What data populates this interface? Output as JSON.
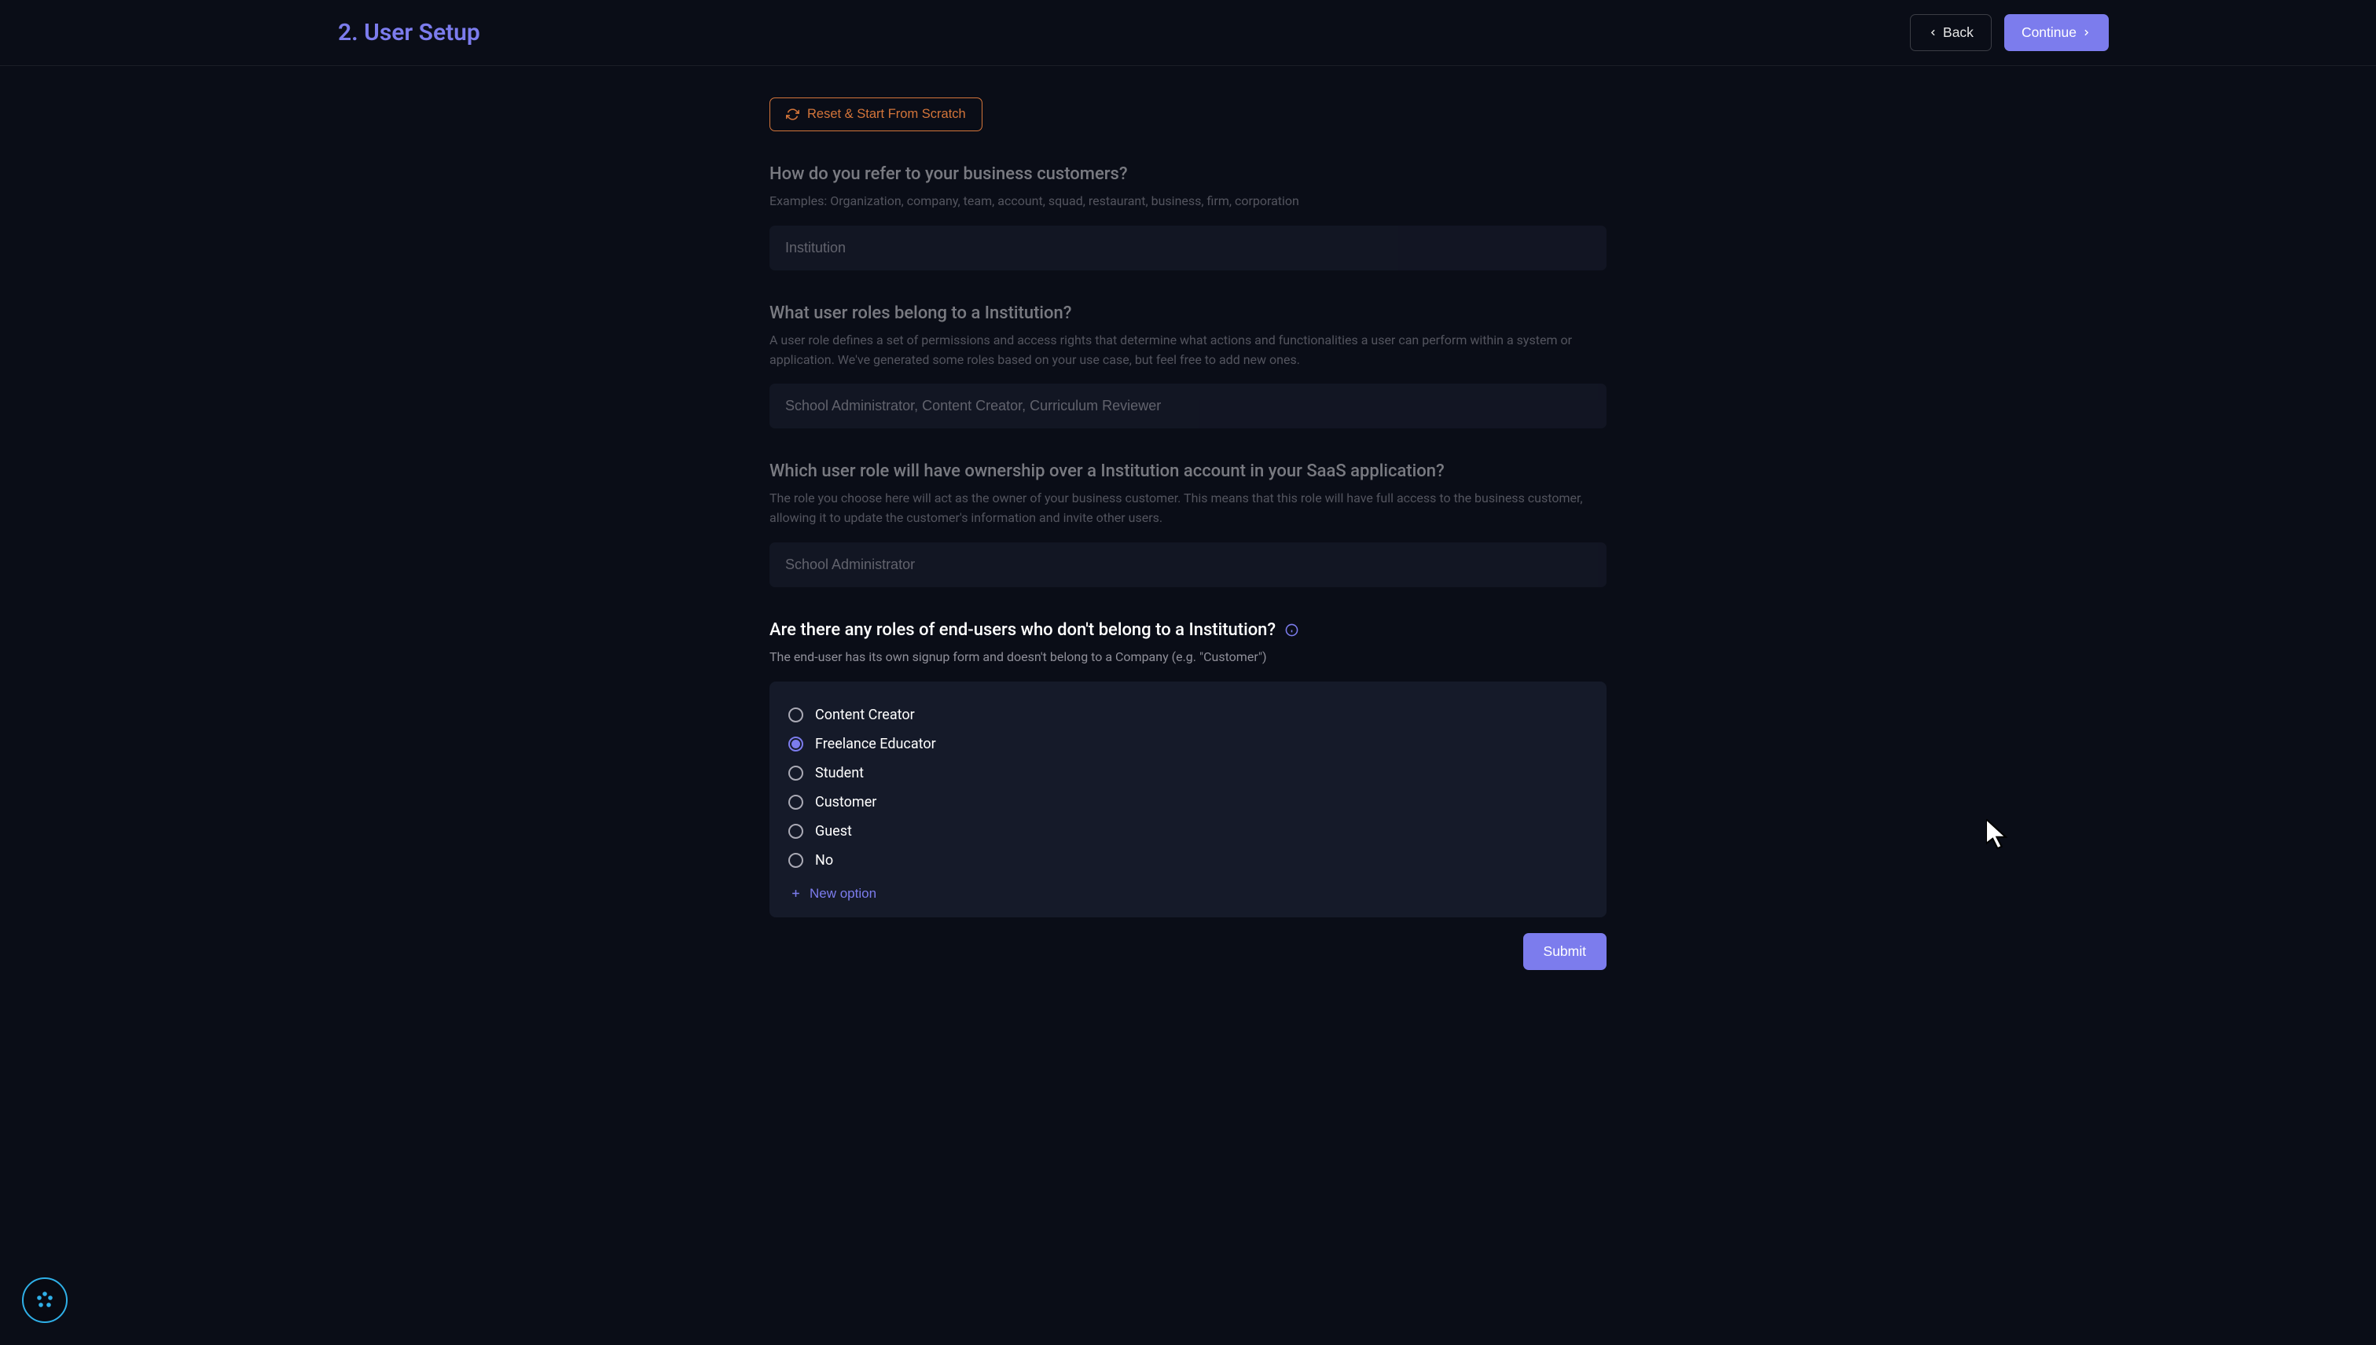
{
  "header": {
    "title": "2. User Setup",
    "back_label": "Back",
    "continue_label": "Continue"
  },
  "reset_label": "Reset & Start From Scratch",
  "section_customer": {
    "heading": "How do you refer to your business customers?",
    "help": "Examples: Organization, company, team, account, squad, restaurant, business, firm, corporation",
    "value": "Institution"
  },
  "section_roles": {
    "heading": "What user roles belong to a Institution?",
    "help": "A user role defines a set of permissions and access rights that determine what actions and functionalities a user can perform within a system or application. We've generated some roles based on your use case, but feel free to add new ones.",
    "value": "School Administrator, Content Creator, Curriculum Reviewer"
  },
  "section_owner": {
    "heading": "Which user role will have ownership over a Institution account in your SaaS application?",
    "help": "The role you choose here will act as the owner of your business customer. This means that this role will have full access to the business customer, allowing it to update the customer's information and invite other users.",
    "value": "School Administrator"
  },
  "section_endusers": {
    "heading": "Are there any roles of end-users who don't belong to a Institution?",
    "help": "The end-user has its own signup form and doesn't belong to a Company (e.g. \"Customer\")",
    "options": [
      {
        "label": "Content Creator",
        "selected": false
      },
      {
        "label": "Freelance Educator",
        "selected": true
      },
      {
        "label": "Student",
        "selected": false
      },
      {
        "label": "Customer",
        "selected": false
      },
      {
        "label": "Guest",
        "selected": false
      },
      {
        "label": "No",
        "selected": false
      }
    ],
    "new_option_label": "New option"
  },
  "submit_label": "Submit",
  "colors": {
    "accent": "#7c7ced",
    "warning": "#d4753a",
    "info": "#2fb0e8",
    "bg": "#0a0d17",
    "card": "#151a29",
    "input": "#191e2e"
  }
}
